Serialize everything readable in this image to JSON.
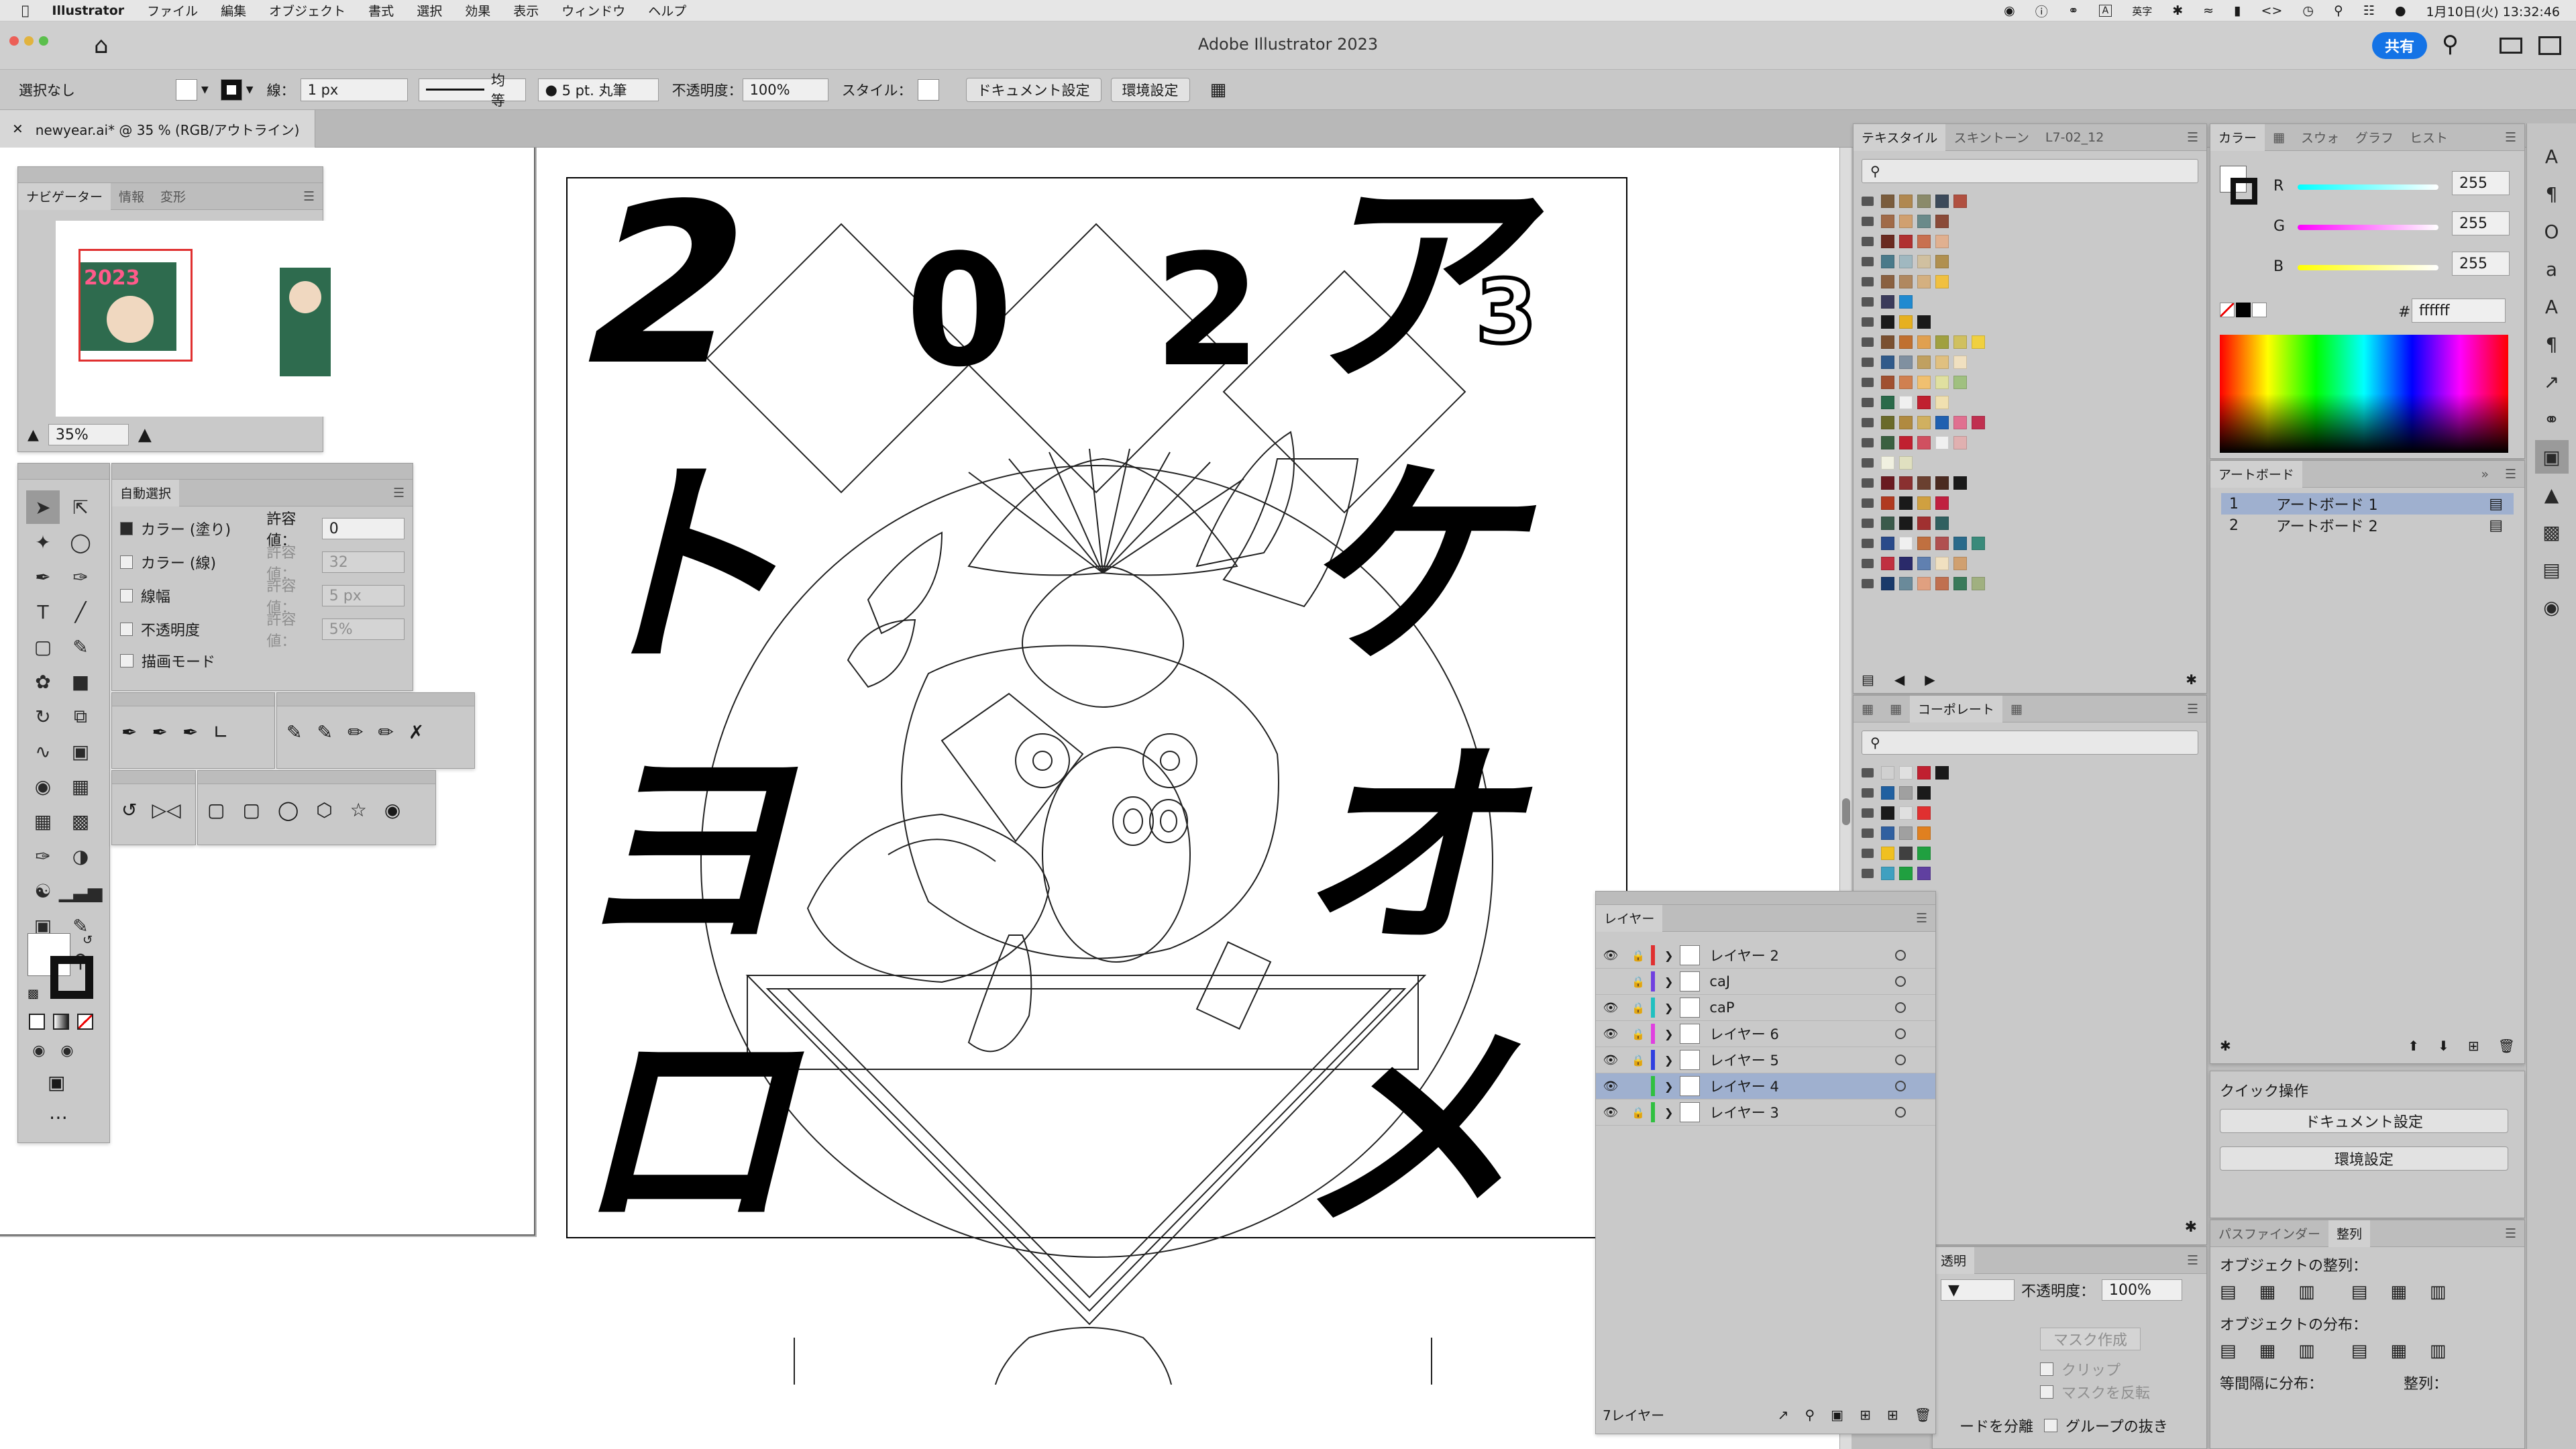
{
  "menubar": {
    "app": "Illustrator",
    "items": [
      "ファイル",
      "編集",
      "オブジェクト",
      "書式",
      "選択",
      "効果",
      "表示",
      "ウィンドウ",
      "ヘルプ"
    ],
    "input_method": "英字",
    "clock": "1月10日(火) 13:32:46"
  },
  "titlebar": {
    "title": "Adobe Illustrator 2023",
    "share_label": "共有"
  },
  "control": {
    "selection": "選択なし",
    "stroke_label": "線：",
    "stroke_width": "1 px",
    "stroke_style": "均等",
    "brush": "5 pt. 丸筆",
    "opacity_label": "不透明度：",
    "opacity_value": "100%",
    "style_label": "スタイル：",
    "doc_setup": "ドキュメント設定",
    "prefs": "環境設定"
  },
  "document": {
    "tab_title": "newyear.ai* @ 35 % (RGB/アウトライン)"
  },
  "navigator": {
    "tabs": [
      "ナビゲーター",
      "情報",
      "変形"
    ],
    "zoom": "35%",
    "thumb_year": "2023"
  },
  "magic_wand": {
    "title": "自動選択",
    "tolerance_label": "許容値：",
    "options": [
      {
        "label": "カラー (塗り)",
        "checked": true,
        "value": "0"
      },
      {
        "label": "カラー (線)",
        "checked": false,
        "value": "32"
      },
      {
        "label": "線幅",
        "checked": false,
        "value": "5 px"
      },
      {
        "label": "不透明度",
        "checked": false,
        "value": "5%"
      },
      {
        "label": "描画モード",
        "checked": false,
        "value": ""
      }
    ]
  },
  "artwork": {
    "chars_left": [
      "2",
      "ト",
      "ヨ",
      "ロ"
    ],
    "chars_right": [
      "ア",
      "ケ",
      "オ",
      "メ"
    ],
    "center_top": [
      "0",
      "2"
    ],
    "rabbit_digit": "3"
  },
  "swatches_panel": {
    "tabs": [
      "テキスタイル",
      "スキントーン",
      "L7-02_12"
    ],
    "colors": [
      [
        "#7a5c3c",
        "#b08850",
        "#8a8a6a",
        "#3c4a5a",
        "#b05040"
      ],
      [
        "#a06a48",
        "#d0a070",
        "#6a8a8a",
        "#8a4a38"
      ],
      [
        "#6a2a20",
        "#b03030",
        "#c87050",
        "#e0b090"
      ],
      [
        "#4a7a8a",
        "#a0b8c0",
        "#d0c0a0",
        "#b09050"
      ],
      [
        "#8a6040",
        "#b08860",
        "#d4b080",
        "#f0c040"
      ],
      [
        "#3a3a5a",
        "#208ad0"
      ],
      [
        "#1a1a1a",
        "#e6b020",
        "#1a1a1a"
      ],
      [
        "#7a5030",
        "#c07030",
        "#e0a050",
        "#a0a040",
        "#d0c060",
        "#f0d040"
      ],
      [
        "#305a8a",
        "#8090a0",
        "#c0a060",
        "#e0c080",
        "#f0e0c0"
      ],
      [
        "#a05030",
        "#d08050",
        "#f0c070",
        "#e0e0a0",
        "#a0c080"
      ],
      [
        "#2a6a4a",
        "#f0f0f0",
        "#c02030",
        "#f0e0b0"
      ],
      [
        "#6a6a2a",
        "#b08a40",
        "#d0b060",
        "#2060b0",
        "#e07090",
        "#c03050"
      ],
      [
        "#3a6040",
        "#c02030",
        "#d05060",
        "#f0f0f0",
        "#e0b0b0"
      ],
      [
        "#f0f0e0",
        "#e0e0c0"
      ],
      [
        "#6a1a20",
        "#8a3030",
        "#6a4030",
        "#4a2a20",
        "#1a1a1a"
      ],
      [
        "#b03a20",
        "#1a1a1a",
        "#d0a040",
        "#c02040"
      ],
      [
        "#3a5a4a",
        "#1a1a1a",
        "#a03030",
        "#306060"
      ],
      [
        "#2a4a8a",
        "#f0f0f0",
        "#c07040",
        "#b05050",
        "#2a6a8a",
        "#3a8a7a"
      ],
      [
        "#c03040",
        "#2a2a6a",
        "#6080b0",
        "#f0e0c0",
        "#d0a070"
      ],
      [
        "#1a3a6a",
        "#6a8a9a",
        "#e0a080",
        "#c07050",
        "#3a7a5a",
        "#a0b080"
      ]
    ]
  },
  "corporate_panel": {
    "active_tab": "コーポレート",
    "colors": [
      [
        "#d0d0d0",
        "#e0e0e0",
        "#c02030",
        "#1a1a1a"
      ],
      [
        "#2060a0",
        "#a0a0a0",
        "#1a1a1a"
      ],
      [
        "#1a1a1a",
        "#e0e0e0",
        "#e03030"
      ],
      [
        "#3060a0",
        "#a0a0a0",
        "#e08020"
      ],
      [
        "#f0c020",
        "#404040",
        "#20a040"
      ],
      [
        "#40a0c0",
        "#20a040",
        "#6040a0"
      ]
    ]
  },
  "color_panel": {
    "tabs": [
      "カラー",
      "スウォ",
      "グラフ",
      "ヒスト"
    ],
    "r": "255",
    "g": "255",
    "b": "255",
    "r_label": "R",
    "g_label": "G",
    "b_label": "B",
    "hex_label": "#",
    "hex": "ffffff"
  },
  "artboards_panel": {
    "title": "アートボード",
    "items": [
      {
        "num": "1",
        "name": "アートボード 1"
      },
      {
        "num": "2",
        "name": "アートボード 2"
      }
    ]
  },
  "quick_actions": {
    "title": "クイック操作",
    "doc_setup": "ドキュメント設定",
    "prefs": "環境設定"
  },
  "align_panel": {
    "tabs": [
      "パスファインダー",
      "整列"
    ],
    "objects_label": "オブジェクトの整列：",
    "distribute_label": "オブジェクトの分布：",
    "spacing_label": "等間隔に分布：",
    "align_to_label": "整列："
  },
  "transparency_panel": {
    "tab": "透明",
    "opacity_label": "不透明度：",
    "opacity": "100%",
    "make_mask": "マスク作成",
    "clip": "クリップ",
    "invert": "マスクを反転",
    "isolate": "ードを分離",
    "knockout": "グループの抜き"
  },
  "layers_panel": {
    "title": "レイヤー",
    "count": "7レイヤー",
    "layers": [
      {
        "name": "レイヤー 2",
        "color": "#e03030",
        "visible": true,
        "locked": true,
        "selected": false
      },
      {
        "name": "caJ",
        "color": "#7040e0",
        "visible": false,
        "locked": true,
        "selected": false
      },
      {
        "name": "caP",
        "color": "#20c0c0",
        "visible": true,
        "locked": true,
        "selected": false
      },
      {
        "name": "レイヤー 6",
        "color": "#e040e0",
        "visible": true,
        "locked": true,
        "selected": false
      },
      {
        "name": "レイヤー 5",
        "color": "#3040e0",
        "visible": true,
        "locked": true,
        "selected": false
      },
      {
        "name": "レイヤー 4",
        "color": "#30c040",
        "visible": true,
        "locked": false,
        "selected": true
      },
      {
        "name": "レイヤー 3",
        "color": "#30c040",
        "visible": true,
        "locked": true,
        "selected": false
      }
    ]
  },
  "icons": {
    "apple": "apple-icon",
    "home": "home-icon",
    "search": "search-icon",
    "eye": "eye-icon",
    "lock": "lock-icon"
  }
}
